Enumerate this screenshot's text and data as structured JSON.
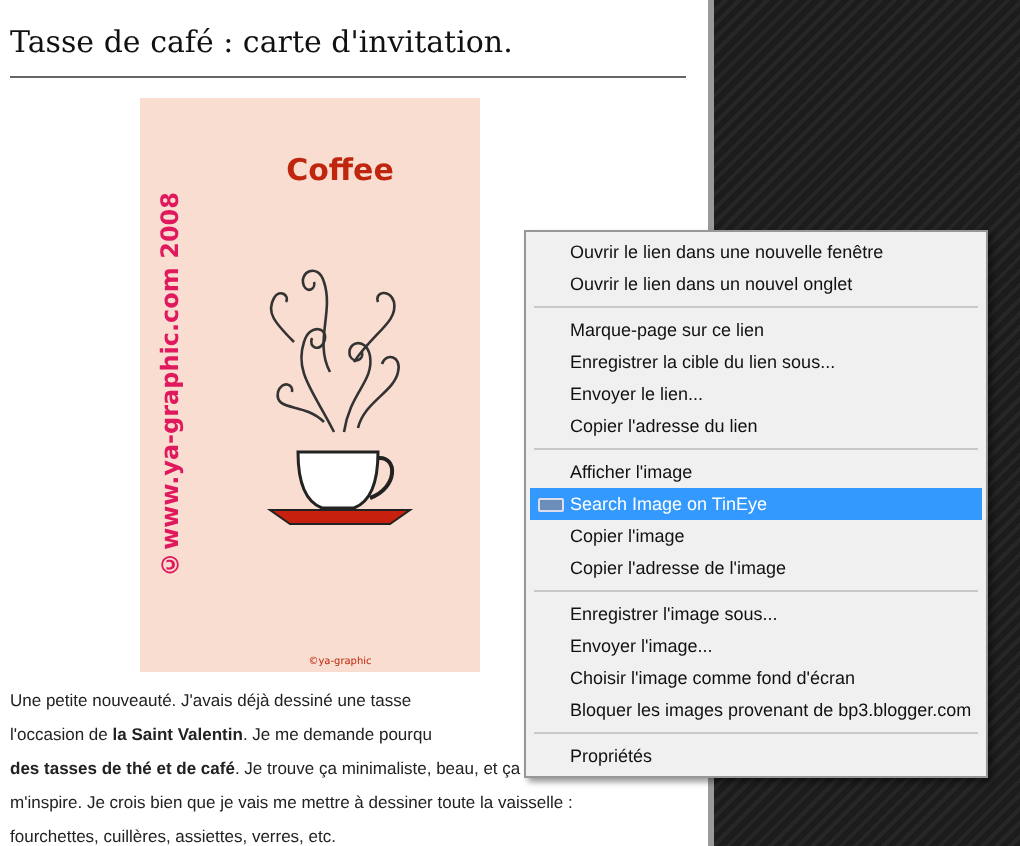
{
  "post": {
    "title": "Tasse de café : carte d'invitation.",
    "poster": {
      "heading": "Coffee",
      "side_text": "©www.ya-graphic.com 2008",
      "signature": "©ya-graphic"
    },
    "paragraph_lines": [
      "Une petite nouveauté. J'avais déjà dessiné une tasse",
      "l'occasion de **la Saint Valentin**. Je me demande pourqu",
      "**des tasses de thé et de café**. Je trouve ça minimaliste, beau, et ça",
      "m'inspire. Je crois bien que je vais me mettre à dessiner toute la vaisselle :",
      "fourchettes, cuillères, assiettes, verres, etc."
    ]
  },
  "context_menu": {
    "items": [
      {
        "kind": "item",
        "label": "Ouvrir le lien dans une nouvelle fenêtre",
        "selected": false
      },
      {
        "kind": "item",
        "label": "Ouvrir le lien dans un nouvel onglet",
        "selected": false
      },
      {
        "kind": "separator"
      },
      {
        "kind": "item",
        "label": "Marque-page sur ce lien",
        "selected": false
      },
      {
        "kind": "item",
        "label": "Enregistrer la cible du lien sous...",
        "selected": false
      },
      {
        "kind": "item",
        "label": "Envoyer le lien...",
        "selected": false
      },
      {
        "kind": "item",
        "label": "Copier l'adresse du lien",
        "selected": false
      },
      {
        "kind": "separator"
      },
      {
        "kind": "item",
        "label": "Afficher l'image",
        "selected": false
      },
      {
        "kind": "icon_item",
        "label": "Search Image on TinEye",
        "selected": true
      },
      {
        "kind": "item",
        "label": "Copier l'image",
        "selected": false
      },
      {
        "kind": "item",
        "label": "Copier l'adresse de l'image",
        "selected": false
      },
      {
        "kind": "separator"
      },
      {
        "kind": "item",
        "label": "Enregistrer l'image sous...",
        "selected": false
      },
      {
        "kind": "item",
        "label": "Envoyer l'image...",
        "selected": false
      },
      {
        "kind": "item",
        "label": "Choisir l'image comme fond d'écran",
        "selected": false
      },
      {
        "kind": "item",
        "label": "Bloquer les images provenant de bp3.blogger.com",
        "selected": false
      },
      {
        "kind": "separator"
      },
      {
        "kind": "item",
        "label": "Propriétés",
        "selected": false
      }
    ]
  }
}
